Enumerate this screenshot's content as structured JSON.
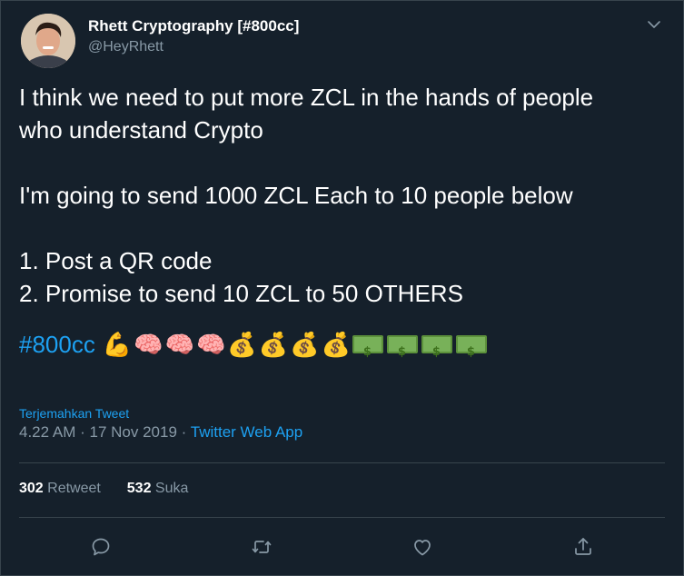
{
  "author": {
    "name": "Rhett Cryptography [#800cc]",
    "handle": "@HeyRhett"
  },
  "tweet": {
    "lines": [
      "I think we need to put more ZCL in the hands of people",
      "who understand Crypto",
      "I'm going to send 1000 ZCL Each to 10 people below",
      "1. Post a QR code",
      "2. Promise to send 10 ZCL to 50 OTHERS"
    ],
    "hashtag": "#800cc",
    "emojis": {
      "muscle": "💪",
      "brain": "🧠",
      "money_bag": "💰",
      "dollar_bill": "💵"
    }
  },
  "translate_label": "Terjemahkan Tweet",
  "meta": {
    "time": "4.22 AM",
    "date": "17 Nov 2019",
    "separator": "·",
    "source": "Twitter Web App"
  },
  "stats": {
    "retweets_count": "302",
    "retweets_label": "Retweet",
    "likes_count": "532",
    "likes_label": "Suka"
  },
  "icons": {
    "reply": "reply-icon",
    "retweet": "retweet-icon",
    "like": "like-icon",
    "share": "share-icon",
    "more": "chevron-down-icon"
  },
  "colors": {
    "background": "#15202b",
    "accent": "#1da1f2",
    "secondary_text": "#8899a6",
    "divider": "#38444d"
  }
}
